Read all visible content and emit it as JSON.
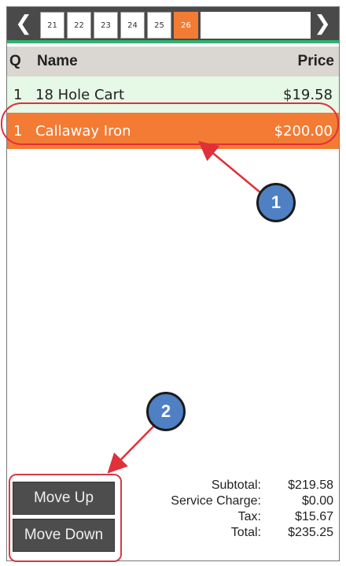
{
  "tabbar": {
    "prev_glyph": "❮",
    "next_glyph": "❯",
    "tabs": [
      {
        "label": "21",
        "active": false
      },
      {
        "label": "22",
        "active": false
      },
      {
        "label": "23",
        "active": false
      },
      {
        "label": "24",
        "active": false
      },
      {
        "label": "25",
        "active": false
      },
      {
        "label": "26",
        "active": true
      }
    ]
  },
  "table": {
    "headers": {
      "q": "Q",
      "name": "Name",
      "price": "Price"
    },
    "rows": [
      {
        "q": "1",
        "name": "18 Hole Cart",
        "price": "$19.58"
      },
      {
        "q": "1",
        "name": "Callaway Iron",
        "price": "$200.00"
      }
    ]
  },
  "callouts": {
    "one": "1",
    "two": "2"
  },
  "buttons": {
    "move_up": "Move Up",
    "move_down": "Move Down"
  },
  "totals": {
    "subtotal_label": "Subtotal:",
    "subtotal_value": "$219.58",
    "service_label": "Service Charge:",
    "service_value": "$0.00",
    "tax_label": "Tax:",
    "tax_value": "$15.67",
    "total_label": "Total:",
    "total_value": "$235.25"
  },
  "colors": {
    "accent": "#f47b34",
    "callout_red": "#e0303a",
    "badge_blue": "#4f80c3",
    "tab_underline": "#2db372"
  }
}
